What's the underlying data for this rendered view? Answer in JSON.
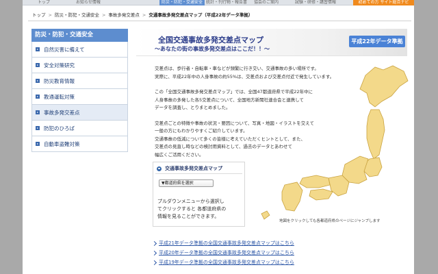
{
  "topnav": {
    "items": [
      "トップ",
      "お知らせ情報",
      "",
      "防災・防犯・交通安全",
      "統計・刊行物・報告書",
      "協会のご案内",
      "試験・研修・講習情報"
    ],
    "cta": "初めての方 サイト総合ナビ"
  },
  "breadcrumb": {
    "items": [
      "トップ",
      "防災・防犯・交通安全",
      "事故多発交差点"
    ],
    "current": "交通事故多発交差点マップ（平成22年データ準拠）"
  },
  "sidebar": {
    "header": "防災・防犯・交通安全",
    "items": [
      {
        "label": "自然災害に備えて"
      },
      {
        "label": "安全対策研究"
      },
      {
        "label": "防災教育情報"
      },
      {
        "label": "教通運転対策"
      },
      {
        "label": "事故多発交差点",
        "active": true
      },
      {
        "label": "防犯のひろば"
      },
      {
        "label": "自動車盗難対策"
      }
    ]
  },
  "hero": {
    "title": "全国交通事故多発交差点マップ",
    "subtitle": "〜あなたの街の事故多発交差点はここだ！！〜",
    "badge": "平成22年データ準拠"
  },
  "intro": {
    "p1": [
      "交差点は、歩行者・自転車・車などが頻繁に行き交い、交通事故の多い場所です。",
      "実際に、平成22年中の人身事故の約55%は、交差点および交差点付近で発生しています。"
    ],
    "p2": [
      "この「全国交通事故多発交差点マップ」では、全国47都道府県で平成22年中に",
      "人身事故の多発した各5交差点について、全国地方新聞社連合会と連携して",
      "データを調査し、とりまとめました。"
    ],
    "p3": [
      "交差点ごとの特徴や事故の状況・要因について、写真・地図・イラストを交えて",
      "一般の方にもわかりやすくご紹介しています。",
      "交通事故の低減について多くの皆様に考えていただくヒントとして、また、",
      "交差点の見直し時などの検討用資料として、過去のデータとあわせて",
      "幅広くご活用ください。"
    ]
  },
  "selector": {
    "title": "交通事故多発交差点マップ",
    "dropdown_value": "▼都道府県を選択",
    "help": [
      "プルダウンメニューから選択し",
      "てクリックすると 各都道府県の",
      "情報を見ることができます。"
    ]
  },
  "map": {
    "caption": "地図をクリックしても各都道府県のページにジャンプします",
    "fill_color": "#f3d98a",
    "stroke_color": "#c9a23f"
  },
  "links": [
    "平成21年データ準拠の全国交通事故多発交差点マップはこちら",
    "平成20年データ準拠の全国交通事故多発交差点マップはこちら",
    "平成19年データ準拠の全国交通事故多発交差点マップはこちら"
  ]
}
